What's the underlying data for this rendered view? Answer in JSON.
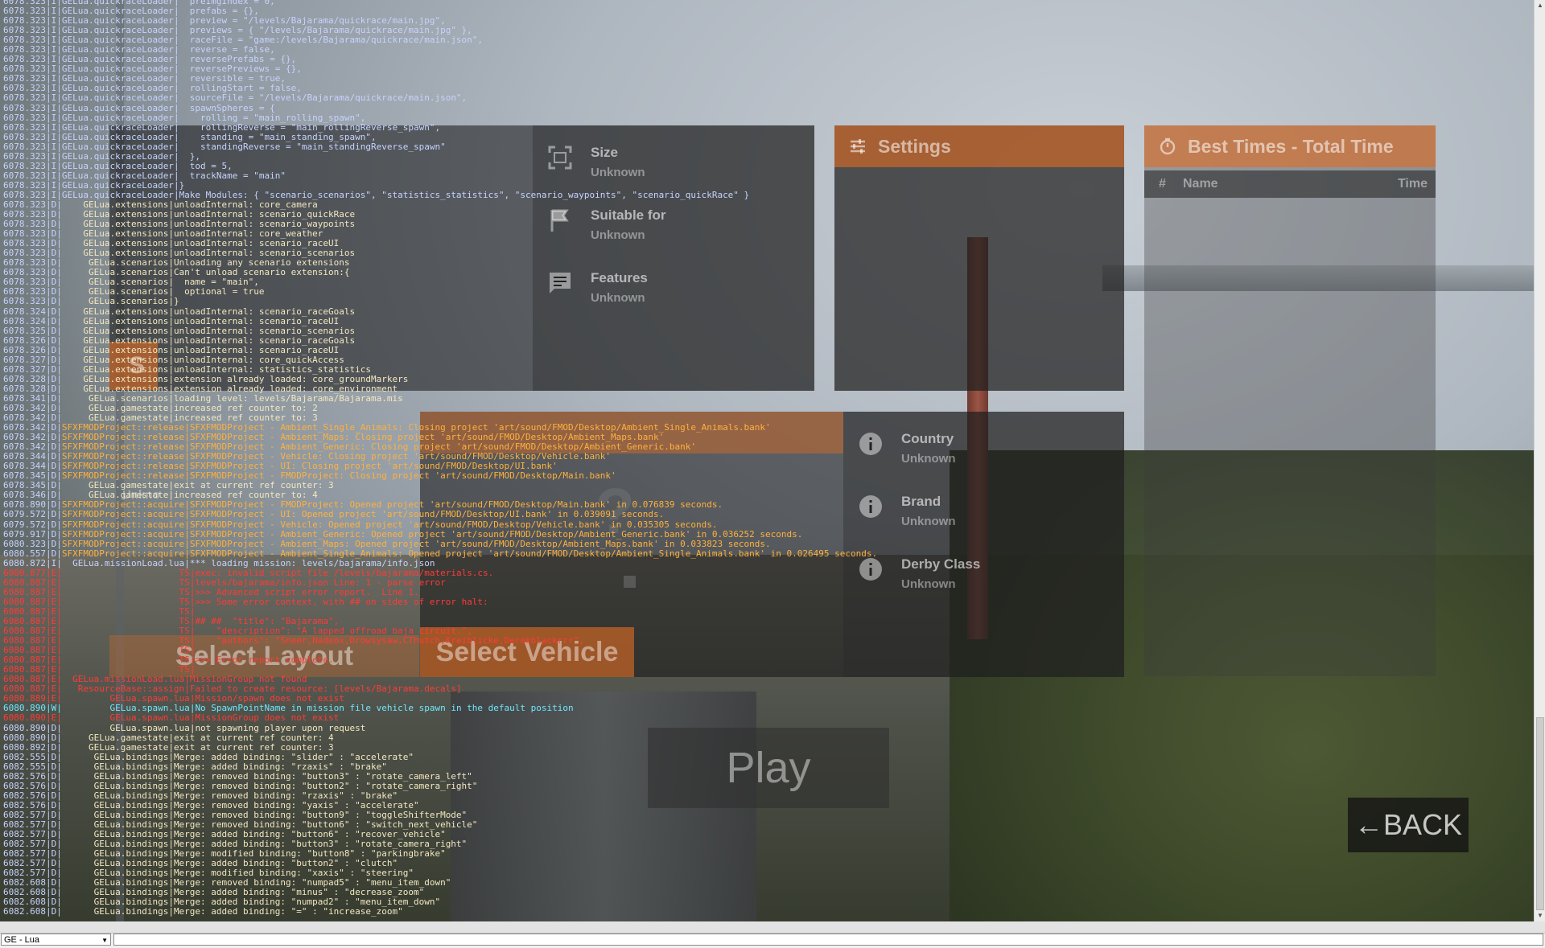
{
  "ui": {
    "level_info": {
      "size_label": "Size",
      "size_value": "Unknown",
      "suitable_label": "Suitable for",
      "suitable_value": "Unknown",
      "features_label": "Features",
      "features_value": "Unknown"
    },
    "settings": {
      "title": "Settings"
    },
    "best_times": {
      "title": "Best Times - Total Time",
      "col_num": "#",
      "col_name": "Name",
      "col_time": "Time"
    },
    "vehicle_info": {
      "country_label": "Country",
      "country_value": "Unknown",
      "brand_label": "Brand",
      "brand_value": "Unknown",
      "derby_label": "Derby Class",
      "derby_value": "Unknown"
    },
    "left_fragments": {
      "s_button": "S",
      "unk_text": "Unkno",
      "question_mark": "?"
    },
    "select_layout_label": "Select Layout",
    "select_vehicle_label": "Select Vehicle",
    "play_label": "Play",
    "back_label": "←BACK"
  },
  "console": {
    "context_select": "GE - Lua",
    "lines": [
      {
        "t": "6078.323",
        "l": "I",
        "s": "GELua.quickraceLoader",
        "m": "  preImgIndex = 0,"
      },
      {
        "t": "6078.323",
        "l": "I",
        "s": "GELua.quickraceLoader",
        "m": "  prefabs = {},"
      },
      {
        "t": "6078.323",
        "l": "I",
        "s": "GELua.quickraceLoader",
        "m": "  preview = \"/levels/Bajarama/quickrace/main.jpg\","
      },
      {
        "t": "6078.323",
        "l": "I",
        "s": "GELua.quickraceLoader",
        "m": "  previews = { \"/levels/Bajarama/quickrace/main.jpg\" },"
      },
      {
        "t": "6078.323",
        "l": "I",
        "s": "GELua.quickraceLoader",
        "m": "  raceFile = \"game:/levels/Bajarama/quickrace/main.json\","
      },
      {
        "t": "6078.323",
        "l": "I",
        "s": "GELua.quickraceLoader",
        "m": "  reverse = false,"
      },
      {
        "t": "6078.323",
        "l": "I",
        "s": "GELua.quickraceLoader",
        "m": "  reversePrefabs = {},"
      },
      {
        "t": "6078.323",
        "l": "I",
        "s": "GELua.quickraceLoader",
        "m": "  reversePreviews = {},"
      },
      {
        "t": "6078.323",
        "l": "I",
        "s": "GELua.quickraceLoader",
        "m": "  reversible = true,"
      },
      {
        "t": "6078.323",
        "l": "I",
        "s": "GELua.quickraceLoader",
        "m": "  rollingStart = false,"
      },
      {
        "t": "6078.323",
        "l": "I",
        "s": "GELua.quickraceLoader",
        "m": "  sourceFile = \"/levels/Bajarama/quickrace/main.json\","
      },
      {
        "t": "6078.323",
        "l": "I",
        "s": "GELua.quickraceLoader",
        "m": "  spawnSpheres = {"
      },
      {
        "t": "6078.323",
        "l": "I",
        "s": "GELua.quickraceLoader",
        "m": "    rolling = \"main_rolling_spawn\","
      },
      {
        "t": "6078.323",
        "l": "I",
        "s": "GELua.quickraceLoader",
        "m": "    rollingReverse = \"main_rollingReverse_spawn\","
      },
      {
        "t": "6078.323",
        "l": "I",
        "s": "GELua.quickraceLoader",
        "m": "    standing = \"main_standing_spawn\","
      },
      {
        "t": "6078.323",
        "l": "I",
        "s": "GELua.quickraceLoader",
        "m": "    standingReverse = \"main_standingReverse_spawn\""
      },
      {
        "t": "6078.323",
        "l": "I",
        "s": "GELua.quickraceLoader",
        "m": "  },"
      },
      {
        "t": "6078.323",
        "l": "I",
        "s": "GELua.quickraceLoader",
        "m": "  tod = 5,"
      },
      {
        "t": "6078.323",
        "l": "I",
        "s": "GELua.quickraceLoader",
        "m": "  trackName = \"main\""
      },
      {
        "t": "6078.323",
        "l": "I",
        "s": "GELua.quickraceLoader",
        "m": "}"
      },
      {
        "t": "6078.323",
        "l": "I",
        "s": "GELua.quickraceLoader",
        "m": "Make Modules: { \"scenario_scenarios\", \"statistics_statistics\", \"scenario_waypoints\", \"scenario_quickRace\" }"
      },
      {
        "t": "6078.323",
        "l": "D",
        "s": "    GELua.extensions",
        "m": "unloadInternal: core_camera"
      },
      {
        "t": "6078.323",
        "l": "D",
        "s": "    GELua.extensions",
        "m": "unloadInternal: scenario_quickRace"
      },
      {
        "t": "6078.323",
        "l": "D",
        "s": "    GELua.extensions",
        "m": "unloadInternal: scenario_waypoints"
      },
      {
        "t": "6078.323",
        "l": "D",
        "s": "    GELua.extensions",
        "m": "unloadInternal: core_weather"
      },
      {
        "t": "6078.323",
        "l": "D",
        "s": "    GELua.extensions",
        "m": "unloadInternal: scenario_raceUI"
      },
      {
        "t": "6078.323",
        "l": "D",
        "s": "    GELua.extensions",
        "m": "unloadInternal: scenario_scenarios"
      },
      {
        "t": "6078.323",
        "l": "D",
        "s": "     GELua.scenarios",
        "m": "Unloading any scenario extensions"
      },
      {
        "t": "6078.323",
        "l": "D",
        "s": "     GELua.scenarios",
        "m": "Can't unload scenario extension:{"
      },
      {
        "t": "6078.323",
        "l": "D",
        "s": "     GELua.scenarios",
        "m": "  name = \"main\","
      },
      {
        "t": "6078.323",
        "l": "D",
        "s": "     GELua.scenarios",
        "m": "  optional = true"
      },
      {
        "t": "6078.323",
        "l": "D",
        "s": "     GELua.scenarios",
        "m": "}"
      },
      {
        "t": "6078.324",
        "l": "D",
        "s": "    GELua.extensions",
        "m": "unloadInternal: scenario_raceGoals"
      },
      {
        "t": "6078.324",
        "l": "D",
        "s": "    GELua.extensions",
        "m": "unloadInternal: scenario_raceUI"
      },
      {
        "t": "6078.325",
        "l": "D",
        "s": "    GELua.extensions",
        "m": "unloadInternal: scenario_scenarios"
      },
      {
        "t": "6078.326",
        "l": "D",
        "s": "    GELua.extensions",
        "m": "unloadInternal: scenario_raceGoals"
      },
      {
        "t": "6078.326",
        "l": "D",
        "s": "    GELua.extensions",
        "m": "unloadInternal: scenario_raceUI"
      },
      {
        "t": "6078.327",
        "l": "D",
        "s": "    GELua.extensions",
        "m": "unloadInternal: core_quickAccess"
      },
      {
        "t": "6078.327",
        "l": "D",
        "s": "    GELua.extensions",
        "m": "unloadInternal: statistics_statistics"
      },
      {
        "t": "6078.328",
        "l": "D",
        "s": "    GELua.extensions",
        "m": "extension already loaded: core_groundMarkers"
      },
      {
        "t": "6078.328",
        "l": "D",
        "s": "    GELua.extensions",
        "m": "extension already loaded: core_environment"
      },
      {
        "t": "6078.341",
        "l": "D",
        "s": "     GELua.scenarios",
        "m": "loading level: levels/Bajarama/Bajarama.mis"
      },
      {
        "t": "6078.342",
        "l": "D",
        "s": "     GELua.gamestate",
        "m": "increased ref counter to: 2"
      },
      {
        "t": "6078.342",
        "l": "D",
        "s": "     GELua.gamestate",
        "m": "increased ref counter to: 3"
      },
      {
        "t": "6078.342",
        "l": "D",
        "s": "SFXFMODProject::release",
        "m": "SFXFMODProject - Ambient_Single_Animals: Closing project 'art/sound/FMOD/Desktop/Ambient_Single_Animals.bank'",
        "o": true
      },
      {
        "t": "6078.342",
        "l": "D",
        "s": "SFXFMODProject::release",
        "m": "SFXFMODProject - Ambient_Maps: Closing project 'art/sound/FMOD/Desktop/Ambient_Maps.bank'",
        "o": true
      },
      {
        "t": "6078.342",
        "l": "D",
        "s": "SFXFMODProject::release",
        "m": "SFXFMODProject - Ambient_Generic: Closing project 'art/sound/FMOD/Desktop/Ambient_Generic.bank'",
        "o": true
      },
      {
        "t": "6078.344",
        "l": "D",
        "s": "SFXFMODProject::release",
        "m": "SFXFMODProject - Vehicle: Closing project 'art/sound/FMOD/Desktop/Vehicle.bank'",
        "o": true
      },
      {
        "t": "6078.344",
        "l": "D",
        "s": "SFXFMODProject::release",
        "m": "SFXFMODProject - UI: Closing project 'art/sound/FMOD/Desktop/UI.bank'",
        "o": true
      },
      {
        "t": "6078.345",
        "l": "D",
        "s": "SFXFMODProject::release",
        "m": "SFXFMODProject - FMODProject: Closing project 'art/sound/FMOD/Desktop/Main.bank'",
        "o": true
      },
      {
        "t": "6078.345",
        "l": "D",
        "s": "     GELua.gamestate",
        "m": "exit at current ref counter: 3"
      },
      {
        "t": "6078.346",
        "l": "D",
        "s": "     GELua.gamestate",
        "m": "increased ref counter to: 4"
      },
      {
        "t": "6078.890",
        "l": "D",
        "s": "SFXFMODProject::acquire",
        "m": "SFXFMODProject - FMODProject: Opened project 'art/sound/FMOD/Desktop/Main.bank' in 0.076839 seconds.",
        "o": true
      },
      {
        "t": "6079.572",
        "l": "D",
        "s": "SFXFMODProject::acquire",
        "m": "SFXFMODProject - UI: Opened project 'art/sound/FMOD/Desktop/UI.bank' in 0.039091 seconds.",
        "o": true
      },
      {
        "t": "6079.572",
        "l": "D",
        "s": "SFXFMODProject::acquire",
        "m": "SFXFMODProject - Vehicle: Opened project 'art/sound/FMOD/Desktop/Vehicle.bank' in 0.035305 seconds.",
        "o": true
      },
      {
        "t": "6079.917",
        "l": "D",
        "s": "SFXFMODProject::acquire",
        "m": "SFXFMODProject - Ambient_Generic: Opened project 'art/sound/FMOD/Desktop/Ambient_Generic.bank' in 0.036252 seconds.",
        "o": true
      },
      {
        "t": "6080.323",
        "l": "D",
        "s": "SFXFMODProject::acquire",
        "m": "SFXFMODProject - Ambient_Maps: Opened project 'art/sound/FMOD/Desktop/Ambient_Maps.bank' in 0.033823 seconds.",
        "o": true
      },
      {
        "t": "6080.557",
        "l": "D",
        "s": "SFXFMODProject::acquire",
        "m": "SFXFMODProject - Ambient_Single_Animals: Opened project 'art/sound/FMOD/Desktop/Ambient_Single_Animals.bank' in 0.026495 seconds.",
        "o": true
      },
      {
        "t": "6080.872",
        "l": "I",
        "s": "  GELua.missionLoad.lua",
        "m": "*** loading mission: levels/bajarama/info.json"
      },
      {
        "t": "6080.877",
        "l": "E",
        "s": "                      TS",
        "m": "exec: invalid script file /levels/bajarama/materials.cs."
      },
      {
        "t": "6080.887",
        "l": "E",
        "s": "                      TS",
        "m": "levels/bajarama/info.json Line: 1 - parse error"
      },
      {
        "t": "6080.887",
        "l": "E",
        "s": "                      TS",
        "m": ">>> Advanced script error report.  Line 1."
      },
      {
        "t": "6080.887",
        "l": "E",
        "s": "                      TS",
        "m": ">>> Some error context, with ## on sides of error halt:"
      },
      {
        "t": "6080.887",
        "l": "E",
        "s": "                      TS",
        "m": ""
      },
      {
        "t": "6080.887",
        "l": "E",
        "s": "                      TS",
        "m": "## ##  \"title\": \"Bajarama\","
      },
      {
        "t": "6080.887",
        "l": "E",
        "s": "                      TS",
        "m": "    \"description\": \"A lapped offroad baja circuit.\","
      },
      {
        "t": "6080.887",
        "l": "E",
        "s": "                      TS",
        "m": "    \"authors\": \"Sneer,Nadeox,Drowsysaw,CThutch,Kreiblicke,Derekblackrrr\","
      },
      {
        "t": "6080.887",
        "l": "E",
        "s": "                      TS",
        "m": ""
      },
      {
        "t": "6080.887",
        "l": "E",
        "s": "                      TS",
        "m": ">>> Error report complete."
      },
      {
        "t": "6080.887",
        "l": "E",
        "s": "                      TS",
        "m": ""
      },
      {
        "t": "6080.887",
        "l": "E",
        "s": "  GELua.missionLoad.lua",
        "m": "MissionGroup not found"
      },
      {
        "t": "6080.887",
        "l": "E",
        "s": "   ResourceBase::assign",
        "m": "Failed to create resource: [levels/Bajarama.decals]"
      },
      {
        "t": "6080.889",
        "l": "E",
        "s": "         GELua.spawn.lua",
        "m": "Mission/spawn does not exist"
      },
      {
        "t": "6080.890",
        "l": "W",
        "s": "         GELua.spawn.lua",
        "m": "No SpawnPointName in mission file vehicle spawn in the default position"
      },
      {
        "t": "6080.890",
        "l": "E",
        "s": "         GELua.spawn.lua",
        "m": "MissionGroup does not exist"
      },
      {
        "t": "6080.890",
        "l": "D",
        "s": "         GELua.spawn.lua",
        "m": "not spawning player upon request"
      },
      {
        "t": "6080.890",
        "l": "D",
        "s": "     GELua.gamestate",
        "m": "exit at current ref counter: 4"
      },
      {
        "t": "6080.892",
        "l": "D",
        "s": "     GELua.gamestate",
        "m": "exit at current ref counter: 3"
      },
      {
        "t": "6082.555",
        "l": "D",
        "s": "      GELua.bindings",
        "m": "Merge: added binding: \"slider\" : \"accelerate\""
      },
      {
        "t": "6082.555",
        "l": "D",
        "s": "      GELua.bindings",
        "m": "Merge: added binding: \"rzaxis\" : \"brake\""
      },
      {
        "t": "6082.576",
        "l": "D",
        "s": "      GELua.bindings",
        "m": "Merge: removed binding: \"button3\" : \"rotate_camera_left\""
      },
      {
        "t": "6082.576",
        "l": "D",
        "s": "      GELua.bindings",
        "m": "Merge: removed binding: \"button2\" : \"rotate_camera_right\""
      },
      {
        "t": "6082.576",
        "l": "D",
        "s": "      GELua.bindings",
        "m": "Merge: removed binding: \"rzaxis\" : \"brake\""
      },
      {
        "t": "6082.576",
        "l": "D",
        "s": "      GELua.bindings",
        "m": "Merge: removed binding: \"yaxis\" : \"accelerate\""
      },
      {
        "t": "6082.577",
        "l": "D",
        "s": "      GELua.bindings",
        "m": "Merge: removed binding: \"button9\" : \"toggleShifterMode\""
      },
      {
        "t": "6082.577",
        "l": "D",
        "s": "      GELua.bindings",
        "m": "Merge: removed binding: \"button6\" : \"switch_next_vehicle\""
      },
      {
        "t": "6082.577",
        "l": "D",
        "s": "      GELua.bindings",
        "m": "Merge: added binding: \"button6\" : \"recover_vehicle\""
      },
      {
        "t": "6082.577",
        "l": "D",
        "s": "      GELua.bindings",
        "m": "Merge: added binding: \"button3\" : \"rotate_camera_right\""
      },
      {
        "t": "6082.577",
        "l": "D",
        "s": "      GELua.bindings",
        "m": "Merge: modified binding: \"button8\" : \"parkingbrake\""
      },
      {
        "t": "6082.577",
        "l": "D",
        "s": "      GELua.bindings",
        "m": "Merge: added binding: \"button2\" : \"clutch\""
      },
      {
        "t": "6082.577",
        "l": "D",
        "s": "      GELua.bindings",
        "m": "Merge: modified binding: \"xaxis\" : \"steering\""
      },
      {
        "t": "6082.608",
        "l": "D",
        "s": "      GELua.bindings",
        "m": "Merge: removed binding: \"numpad5\" : \"menu_item_down\""
      },
      {
        "t": "6082.608",
        "l": "D",
        "s": "      GELua.bindings",
        "m": "Merge: added binding: \"minus\" : \"decrease_zoom\""
      },
      {
        "t": "6082.608",
        "l": "D",
        "s": "      GELua.bindings",
        "m": "Merge: added binding: \"numpad2\" : \"menu_item_down\""
      },
      {
        "t": "6082.608",
        "l": "D",
        "s": "      GELua.bindings",
        "m": "Merge: added binding: \"=\" : \"increase_zoom\""
      }
    ]
  },
  "colors": {
    "accent_orange": "#de6c24",
    "log_info": "#c6d3ff",
    "log_debug": "#f3e8c0",
    "log_sfx": "#ffb13d",
    "log_error": "#ff3b36",
    "log_warning": "#6fe7ff"
  }
}
